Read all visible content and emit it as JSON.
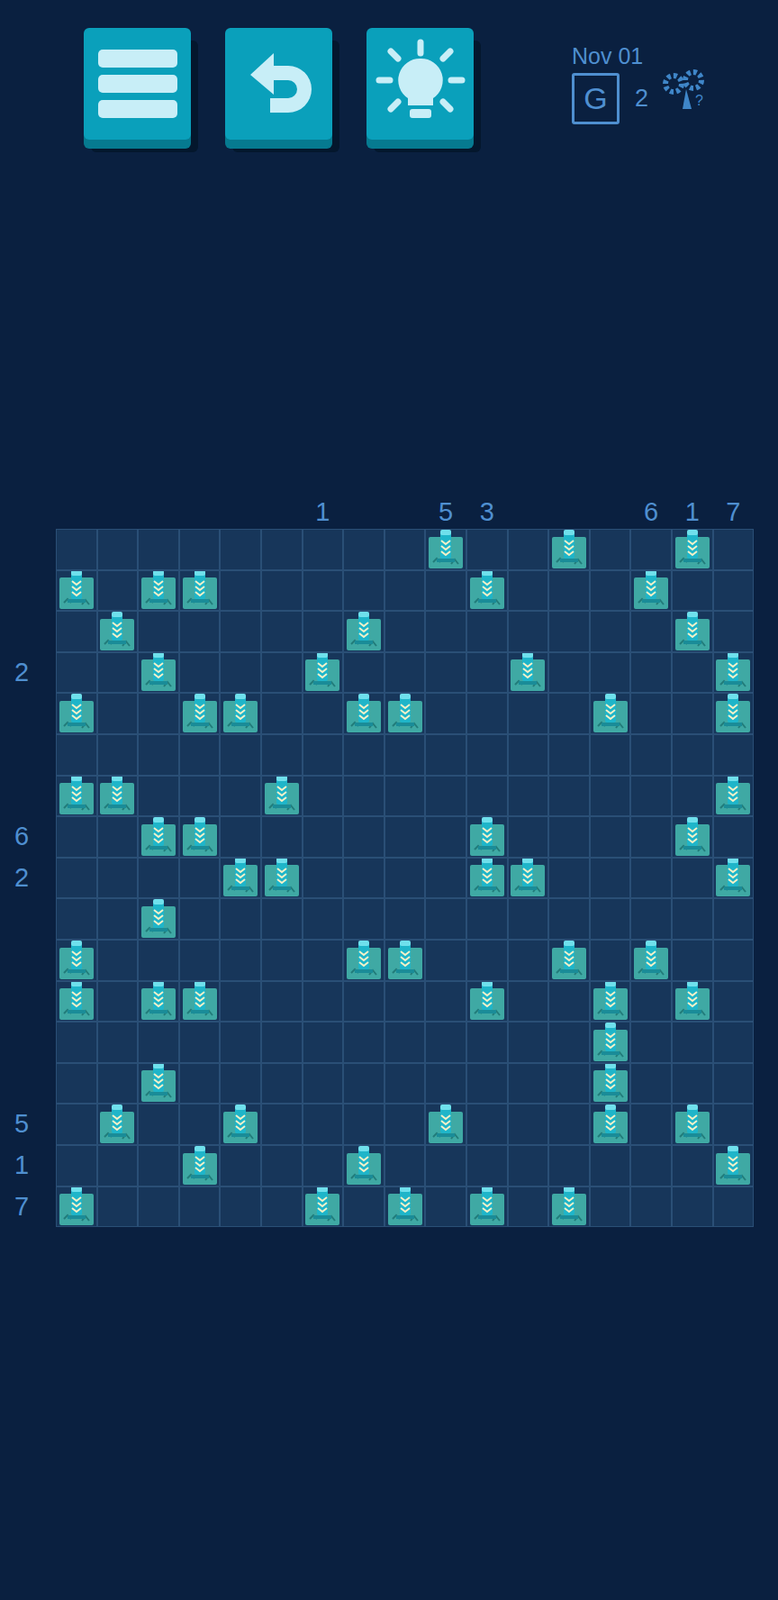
{
  "header": {
    "date": "Nov 01",
    "badge": "G",
    "count": "2"
  },
  "board": {
    "column_clues": [
      "",
      "",
      "",
      "",
      "",
      "",
      "1",
      "",
      "",
      "5",
      "3",
      "",
      "",
      "",
      "6",
      "1",
      "7"
    ],
    "rows": [
      {
        "clue": "",
        "towers": [
          false,
          false,
          false,
          false,
          false,
          false,
          false,
          false,
          false,
          true,
          false,
          false,
          true,
          false,
          false,
          true,
          false
        ]
      },
      {
        "clue": "",
        "towers": [
          true,
          false,
          true,
          true,
          false,
          false,
          false,
          false,
          false,
          false,
          true,
          false,
          false,
          false,
          true,
          false,
          false
        ]
      },
      {
        "clue": "",
        "towers": [
          false,
          true,
          false,
          false,
          false,
          false,
          false,
          true,
          false,
          false,
          false,
          false,
          false,
          false,
          false,
          true,
          false
        ]
      },
      {
        "clue": "2",
        "towers": [
          false,
          false,
          true,
          false,
          false,
          false,
          true,
          false,
          false,
          false,
          false,
          true,
          false,
          false,
          false,
          false,
          true
        ]
      },
      {
        "clue": "",
        "towers": [
          true,
          false,
          false,
          true,
          true,
          false,
          false,
          true,
          true,
          false,
          false,
          false,
          false,
          true,
          false,
          false,
          true
        ]
      },
      {
        "clue": "",
        "towers": [
          false,
          false,
          false,
          false,
          false,
          false,
          false,
          false,
          false,
          false,
          false,
          false,
          false,
          false,
          false,
          false,
          false
        ]
      },
      {
        "clue": "",
        "towers": [
          true,
          true,
          false,
          false,
          false,
          true,
          false,
          false,
          false,
          false,
          false,
          false,
          false,
          false,
          false,
          false,
          true
        ]
      },
      {
        "clue": "6",
        "towers": [
          false,
          false,
          true,
          true,
          false,
          false,
          false,
          false,
          false,
          false,
          true,
          false,
          false,
          false,
          false,
          true,
          false
        ]
      },
      {
        "clue": "2",
        "towers": [
          false,
          false,
          false,
          false,
          true,
          true,
          false,
          false,
          false,
          false,
          true,
          true,
          false,
          false,
          false,
          false,
          true
        ]
      },
      {
        "clue": "",
        "towers": [
          false,
          false,
          true,
          false,
          false,
          false,
          false,
          false,
          false,
          false,
          false,
          false,
          false,
          false,
          false,
          false,
          false
        ]
      },
      {
        "clue": "",
        "towers": [
          true,
          false,
          false,
          false,
          false,
          false,
          false,
          true,
          true,
          false,
          false,
          false,
          true,
          false,
          true,
          false,
          false
        ]
      },
      {
        "clue": "",
        "towers": [
          true,
          false,
          true,
          true,
          false,
          false,
          false,
          false,
          false,
          false,
          true,
          false,
          false,
          true,
          false,
          true,
          false
        ]
      },
      {
        "clue": "",
        "towers": [
          false,
          false,
          false,
          false,
          false,
          false,
          false,
          false,
          false,
          false,
          false,
          false,
          false,
          true,
          false,
          false,
          false
        ]
      },
      {
        "clue": "",
        "towers": [
          false,
          false,
          true,
          false,
          false,
          false,
          false,
          false,
          false,
          false,
          false,
          false,
          false,
          true,
          false,
          false,
          false
        ]
      },
      {
        "clue": "5",
        "towers": [
          false,
          true,
          false,
          false,
          true,
          false,
          false,
          false,
          false,
          true,
          false,
          false,
          false,
          true,
          false,
          true,
          false
        ]
      },
      {
        "clue": "1",
        "towers": [
          false,
          false,
          false,
          true,
          false,
          false,
          false,
          true,
          false,
          false,
          false,
          false,
          false,
          false,
          false,
          false,
          true
        ]
      },
      {
        "clue": "7",
        "towers": [
          true,
          false,
          false,
          false,
          false,
          false,
          true,
          false,
          true,
          false,
          true,
          false,
          true,
          false,
          false,
          false,
          false
        ]
      }
    ]
  }
}
